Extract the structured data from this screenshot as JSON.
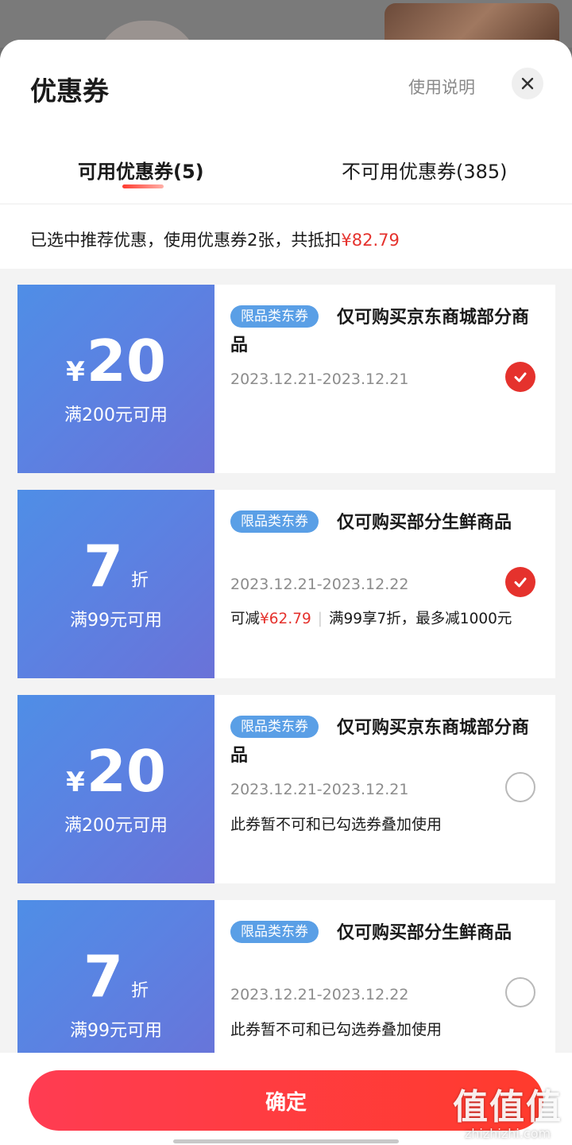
{
  "sheet": {
    "title": "优惠券",
    "help_link": "使用说明",
    "tabs": [
      {
        "label": "可用优惠券(5)",
        "active": true
      },
      {
        "label": "不可用优惠券(385)",
        "active": false
      }
    ],
    "summary_text": "已选中推荐优惠，使用优惠券2张，共抵扣",
    "summary_amount": "¥82.79"
  },
  "coupons": [
    {
      "currency": "¥",
      "value": "20",
      "unit": "",
      "condition": "满200元可用",
      "tag": "限品类东券",
      "name": "仅可购买京东商城部分商品",
      "date": "2023.12.21-2023.12.21",
      "selected": true
    },
    {
      "currency": "",
      "value": "7",
      "unit": "折",
      "condition": "满99元可用",
      "tag": "限品类东券",
      "name": "仅可购买部分生鲜商品",
      "date": "2023.12.21-2023.12.22",
      "note_prefix": "可减",
      "note_amount": "¥62.79",
      "note_rest": "满99享7折，最多减1000元",
      "selected": true
    },
    {
      "currency": "¥",
      "value": "20",
      "unit": "",
      "condition": "满200元可用",
      "tag": "限品类东券",
      "name": "仅可购买京东商城部分商品",
      "date": "2023.12.21-2023.12.21",
      "note": "此券暂不可和已勾选券叠加使用",
      "selected": false
    },
    {
      "currency": "",
      "value": "7",
      "unit": "折",
      "condition": "满99元可用",
      "tag": "限品类东券",
      "name": "仅可购买部分生鲜商品",
      "date": "2023.12.21-2023.12.22",
      "note": "此券暂不可和已勾选券叠加使用",
      "selected": false
    }
  ],
  "confirm_label": "确定",
  "watermark": {
    "mark": "值值值",
    "site": "zhizhizhi.com"
  },
  "colors": {
    "accent": "#e5322d",
    "coupon_blue": "#5b82e2",
    "tag_blue": "#5a9fe6"
  },
  "icons": {
    "close": "close-icon",
    "check": "check-icon"
  }
}
